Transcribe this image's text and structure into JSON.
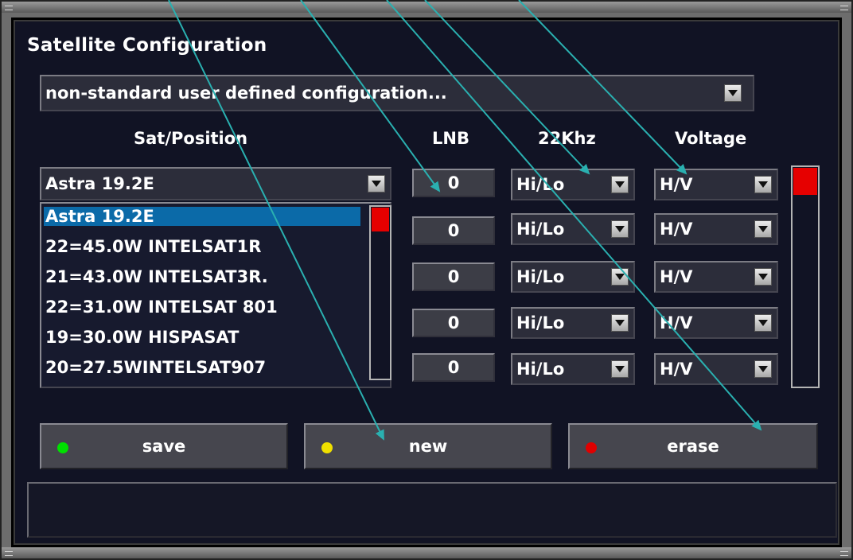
{
  "window": {
    "title": "Satellite Configuration"
  },
  "config_select": {
    "value": "non-standard user defined configuration..."
  },
  "headers": {
    "sat_position": "Sat/Position",
    "lnb": "LNB",
    "khz22": "22Khz",
    "voltage": "Voltage"
  },
  "sat_select": {
    "value": "Astra 19.2E"
  },
  "sat_list": [
    "Astra 19.2E",
    "22=45.0W INTELSAT1R",
    "21=43.0W INTELSAT3R.",
    "22=31.0W INTELSAT 801",
    "19=30.0W HISPASAT",
    "20=27.5WINTELSAT907"
  ],
  "rows": [
    {
      "lnb": "0",
      "khz22": "Hi/Lo",
      "voltage": "H/V"
    },
    {
      "lnb": "0",
      "khz22": "Hi/Lo",
      "voltage": "H/V"
    },
    {
      "lnb": "0",
      "khz22": "Hi/Lo",
      "voltage": "H/V"
    },
    {
      "lnb": "0",
      "khz22": "Hi/Lo",
      "voltage": "H/V"
    },
    {
      "lnb": "0",
      "khz22": "Hi/Lo",
      "voltage": "H/V"
    }
  ],
  "buttons": {
    "save": {
      "label": "save",
      "dot_color": "#00e000"
    },
    "new": {
      "label": "new",
      "dot_color": "#f0e000"
    },
    "erase": {
      "label": "erase",
      "dot_color": "#e00000"
    }
  },
  "colors": {
    "selection": "#0b6aa8",
    "scroll_thumb": "#e60000",
    "annotation_arrow": "#2ab0b0"
  }
}
